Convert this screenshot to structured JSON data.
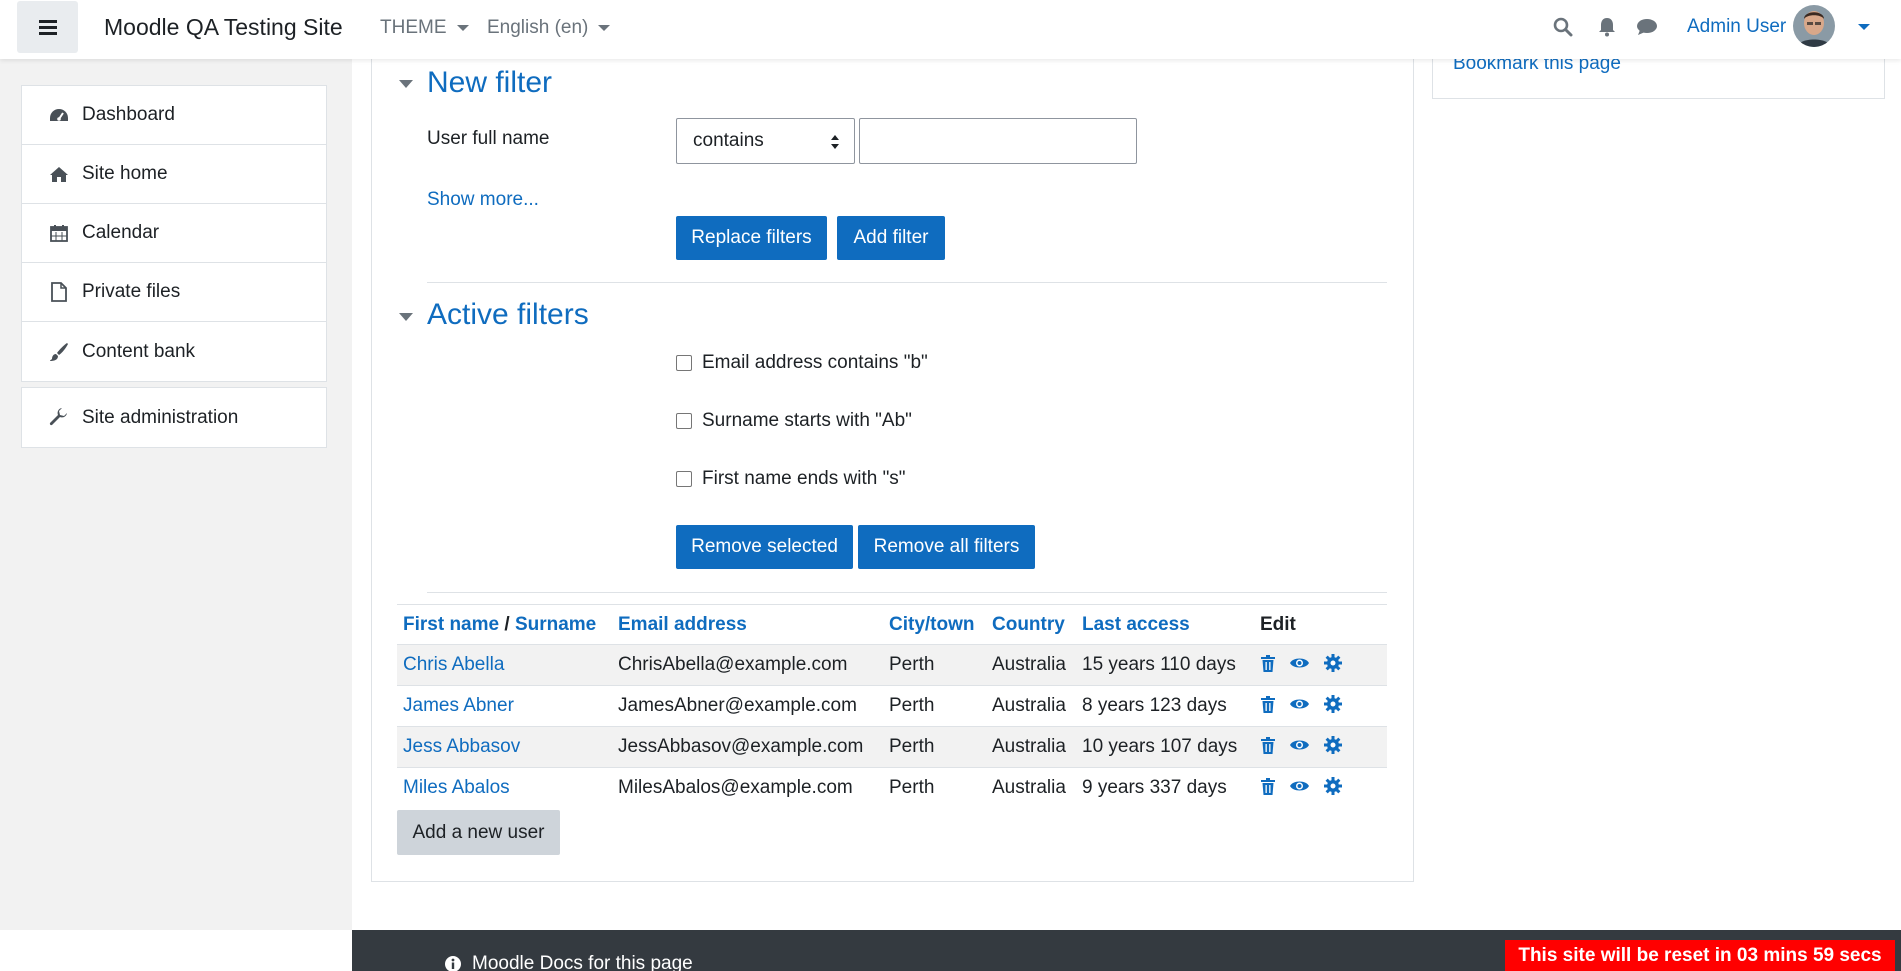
{
  "header": {
    "site_name": "Moodle QA Testing Site",
    "theme_label": "THEME",
    "language_label": "English (en)",
    "user_name": "Admin User"
  },
  "sidebar": {
    "items": [
      {
        "label": "Dashboard",
        "icon": "dashboard-icon"
      },
      {
        "label": "Site home",
        "icon": "home-icon"
      },
      {
        "label": "Calendar",
        "icon": "calendar-icon"
      },
      {
        "label": "Private files",
        "icon": "file-icon"
      },
      {
        "label": "Content bank",
        "icon": "paintbrush-icon"
      }
    ],
    "admin_item": {
      "label": "Site administration",
      "icon": "wrench-icon"
    }
  },
  "block": {
    "bookmark_link": "Bookmark this page"
  },
  "new_filter": {
    "title": "New filter",
    "field_label": "User full name",
    "operator_value": "contains",
    "text_value": "",
    "show_more": "Show more...",
    "replace_button": "Replace filters",
    "add_button": "Add filter"
  },
  "active_filters": {
    "title": "Active filters",
    "filters": [
      {
        "label": "Email address contains \"b\"",
        "checked": false
      },
      {
        "label": "Surname starts with \"Ab\"",
        "checked": false
      },
      {
        "label": "First name ends with \"s\"",
        "checked": false
      }
    ],
    "remove_selected_button": "Remove selected",
    "remove_all_button": "Remove all filters"
  },
  "table": {
    "headers": {
      "first_name": "First name",
      "separator": " / ",
      "surname": "Surname",
      "email": "Email address",
      "city": "City/town",
      "country": "Country",
      "last_access": "Last access",
      "edit": "Edit"
    },
    "rows": [
      {
        "name": "Chris Abella",
        "email": "ChrisAbella@example.com",
        "city": "Perth",
        "country": "Australia",
        "last_access": "15 years 110 days"
      },
      {
        "name": "James Abner",
        "email": "JamesAbner@example.com",
        "city": "Perth",
        "country": "Australia",
        "last_access": "8 years 123 days"
      },
      {
        "name": "Jess Abbasov",
        "email": "JessAbbasov@example.com",
        "city": "Perth",
        "country": "Australia",
        "last_access": "10 years 107 days"
      },
      {
        "name": "Miles Abalos",
        "email": "MilesAbalos@example.com",
        "city": "Perth",
        "country": "Australia",
        "last_access": "9 years 337 days"
      }
    ]
  },
  "add_user_button": "Add a new user",
  "footer": {
    "docs_link": "Moodle Docs for this page",
    "reset_banner": "This site will be reset in 03 mins 59 secs"
  },
  "colors": {
    "brand": "#0f6cbf",
    "banner": "#ff0000",
    "footer": "#343a40"
  }
}
